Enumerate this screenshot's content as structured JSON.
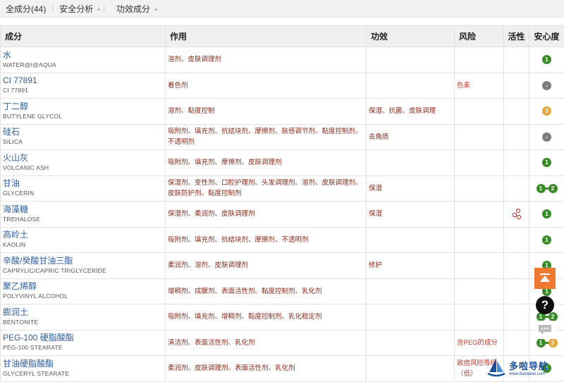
{
  "tabs": [
    {
      "label": "全成分(44)"
    },
    {
      "label": "安全分析"
    },
    {
      "label": "功效成分"
    }
  ],
  "table": {
    "headers": {
      "ingredient": "成分",
      "function": "作用",
      "efficacy": "功效",
      "risk": "风险",
      "active": "活性",
      "safety": "安心度"
    },
    "rows": [
      {
        "cn": "水",
        "en": "WATER@I@AQUA",
        "function": "溶剂、皮肤调理剂",
        "efficacy": "",
        "risk": "",
        "active": false,
        "safety": [
          "1"
        ]
      },
      {
        "cn": "CI 77891",
        "en": "CI 77891",
        "function": "着色剂",
        "efficacy": "",
        "risk": "色素",
        "active": false,
        "safety": [
          "-"
        ]
      },
      {
        "cn": "丁二醇",
        "en": "BUTYLENE GLYCOL",
        "function": "溶剂、黏度控制",
        "efficacy": "保湿、抗菌、皮肤调理",
        "risk": "",
        "active": false,
        "safety": [
          "3"
        ]
      },
      {
        "cn": "硅石",
        "en": "SILICA",
        "function": "吸附剂、填充剂、抗结块剂、摩擦剂、肤感调节剂、黏度控制剂、不透明剂",
        "efficacy": "去角质",
        "risk": "",
        "active": false,
        "safety": [
          "-"
        ]
      },
      {
        "cn": "火山灰",
        "en": "VOLCANIC ASH",
        "function": "吸附剂、填充剂、摩擦剂、皮肤调理剂",
        "efficacy": "",
        "risk": "",
        "active": false,
        "safety": [
          "1"
        ]
      },
      {
        "cn": "甘油",
        "en": "GLYCERIN",
        "function": "保湿剂、变性剂、口腔护理剂、头发调理剂、溶剂、皮肤调理剂、皮肤防护剂、黏度控制剂",
        "efficacy": "保湿",
        "risk": "",
        "active": false,
        "safety": [
          "1",
          "2"
        ]
      },
      {
        "cn": "海藻糖",
        "en": "TREHALOSE",
        "function": "保湿剂、柔润剂、皮肤调理剂",
        "efficacy": "保湿",
        "risk": "",
        "active": true,
        "safety": [
          "1"
        ]
      },
      {
        "cn": "高岭土",
        "en": "KAOLIN",
        "function": "吸附剂、填充剂、抗结块剂、摩擦剂、不透明剂",
        "efficacy": "",
        "risk": "",
        "active": false,
        "safety": [
          "1"
        ]
      },
      {
        "cn": "辛酸/癸酸甘油三酯",
        "en": "CAPRYLIC/CAPRIC TRIGLYCERIDE",
        "function": "柔润剂、溶剂、皮肤调理剂",
        "efficacy": "修护",
        "risk": "",
        "active": false,
        "safety": [
          "1"
        ]
      },
      {
        "cn": "聚乙烯醇",
        "en": "POLYVINYL ALCOHOL",
        "function": "增稠剂、成膜剂、表面活性剂、黏度控制剂、乳化剂",
        "efficacy": "",
        "risk": "",
        "active": false,
        "safety": [
          "1"
        ]
      },
      {
        "cn": "膨润土",
        "en": "BENTONITE",
        "function": "吸附剂、填充剂、增稠剂、黏度控制剂、乳化稳定剂",
        "efficacy": "",
        "risk": "",
        "active": false,
        "safety": [
          "1",
          "2"
        ]
      },
      {
        "cn": "PEG-100 硬脂酸酯",
        "en": "PEG-100 STEARATE",
        "function": "清洁剂、表面活性剂、乳化剂",
        "efficacy": "",
        "risk": "含PEG的成分",
        "active": false,
        "safety": [
          "1",
          "3"
        ]
      },
      {
        "cn": "甘油硬脂酸酯",
        "en": "GLYCERYL STEARATE",
        "function": "柔润剂、皮肤调理剂、表面活性剂、乳化剂",
        "efficacy": "",
        "risk": "致痘风险等级（低）",
        "active": false,
        "safety": [
          "1"
        ]
      }
    ]
  },
  "floating": {
    "help_glyph": "?"
  },
  "watermark": {
    "main": "多啦导航",
    "sub": "www.duolawei.com"
  },
  "colors": {
    "green": "#3a8a2a",
    "gray": "#7d7d7d",
    "orange": "#e3a53a",
    "accent": "#ee7a32",
    "link": "#2f5f9e"
  }
}
